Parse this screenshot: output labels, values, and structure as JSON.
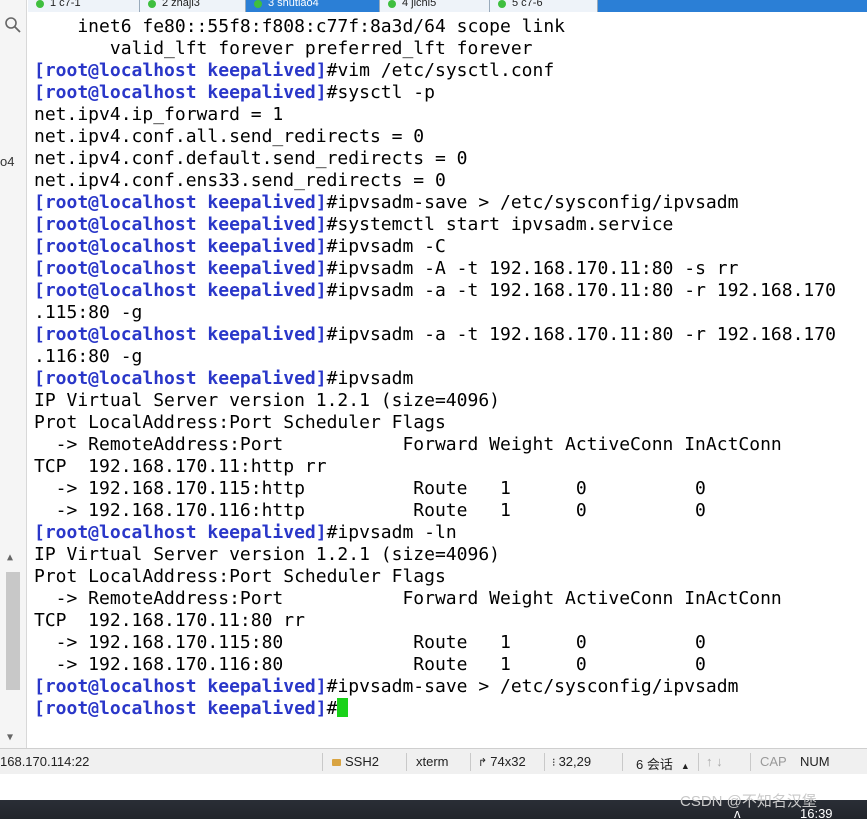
{
  "tabs": [
    {
      "label": "1 c7-1",
      "active": false
    },
    {
      "label": "2 zhaji3",
      "active": false
    },
    {
      "label": "3 shutiao4",
      "active": true
    },
    {
      "label": "4 jichi5",
      "active": false
    },
    {
      "label": "5 c7-6",
      "active": false
    }
  ],
  "gutter": {
    "edge_text": "o4",
    "up_arrow": "▲",
    "down_arrow": "▼"
  },
  "terminal": {
    "lines": [
      {
        "p": "",
        "t": "    inet6 fe80::55f8:f808:c77f:8a3d/64 scope link"
      },
      {
        "p": "",
        "t": "       valid_lft forever preferred_lft forever"
      },
      {
        "p": "[root@localhost keepalived]",
        "t": "#vim /etc/sysctl.conf"
      },
      {
        "p": "[root@localhost keepalived]",
        "t": "#sysctl -p"
      },
      {
        "p": "",
        "t": "net.ipv4.ip_forward = 1"
      },
      {
        "p": "",
        "t": "net.ipv4.conf.all.send_redirects = 0"
      },
      {
        "p": "",
        "t": "net.ipv4.conf.default.send_redirects = 0"
      },
      {
        "p": "",
        "t": "net.ipv4.conf.ens33.send_redirects = 0"
      },
      {
        "p": "[root@localhost keepalived]",
        "t": "#ipvsadm-save > /etc/sysconfig/ipvsadm"
      },
      {
        "p": "[root@localhost keepalived]",
        "t": "#systemctl start ipvsadm.service"
      },
      {
        "p": "[root@localhost keepalived]",
        "t": "#ipvsadm -C"
      },
      {
        "p": "[root@localhost keepalived]",
        "t": "#ipvsadm -A -t 192.168.170.11:80 -s rr"
      },
      {
        "p": "[root@localhost keepalived]",
        "t": "#ipvsadm -a -t 192.168.170.11:80 -r 192.168.170"
      },
      {
        "p": "",
        "t": ".115:80 -g"
      },
      {
        "p": "[root@localhost keepalived]",
        "t": "#ipvsadm -a -t 192.168.170.11:80 -r 192.168.170"
      },
      {
        "p": "",
        "t": ".116:80 -g"
      },
      {
        "p": "[root@localhost keepalived]",
        "t": "#ipvsadm"
      },
      {
        "p": "",
        "t": "IP Virtual Server version 1.2.1 (size=4096)"
      },
      {
        "p": "",
        "t": "Prot LocalAddress:Port Scheduler Flags"
      },
      {
        "p": "",
        "t": "  -> RemoteAddress:Port           Forward Weight ActiveConn InActConn"
      },
      {
        "p": "",
        "t": "TCP  192.168.170.11:http rr"
      },
      {
        "p": "",
        "t": "  -> 192.168.170.115:http          Route   1      0          0"
      },
      {
        "p": "",
        "t": "  -> 192.168.170.116:http          Route   1      0          0"
      },
      {
        "p": "[root@localhost keepalived]",
        "t": "#ipvsadm -ln"
      },
      {
        "p": "",
        "t": "IP Virtual Server version 1.2.1 (size=4096)"
      },
      {
        "p": "",
        "t": "Prot LocalAddress:Port Scheduler Flags"
      },
      {
        "p": "",
        "t": "  -> RemoteAddress:Port           Forward Weight ActiveConn InActConn"
      },
      {
        "p": "",
        "t": "TCP  192.168.170.11:80 rr"
      },
      {
        "p": "",
        "t": "  -> 192.168.170.115:80            Route   1      0          0"
      },
      {
        "p": "",
        "t": "  -> 192.168.170.116:80            Route   1      0          0"
      },
      {
        "p": "[root@localhost keepalived]",
        "t": "#ipvsadm-save > /etc/sysconfig/ipvsadm"
      },
      {
        "p": "[root@localhost keepalived]",
        "t": "#",
        "cursor": true
      }
    ]
  },
  "status": {
    "host": "168.170.114:22",
    "protocol": "SSH2",
    "termtype": "xterm",
    "size": "74x32",
    "position": "32,29",
    "sessions": "6 会话",
    "cap": "CAP",
    "num": "NUM"
  },
  "taskbar": {
    "clock": "16:39",
    "watermark": "CSDN @不知名汉堡",
    "tray": "ʌ"
  },
  "colors": {
    "prompt": "#2a37c9",
    "cursor": "#19d219",
    "tab_active": "#2b7fd6"
  }
}
